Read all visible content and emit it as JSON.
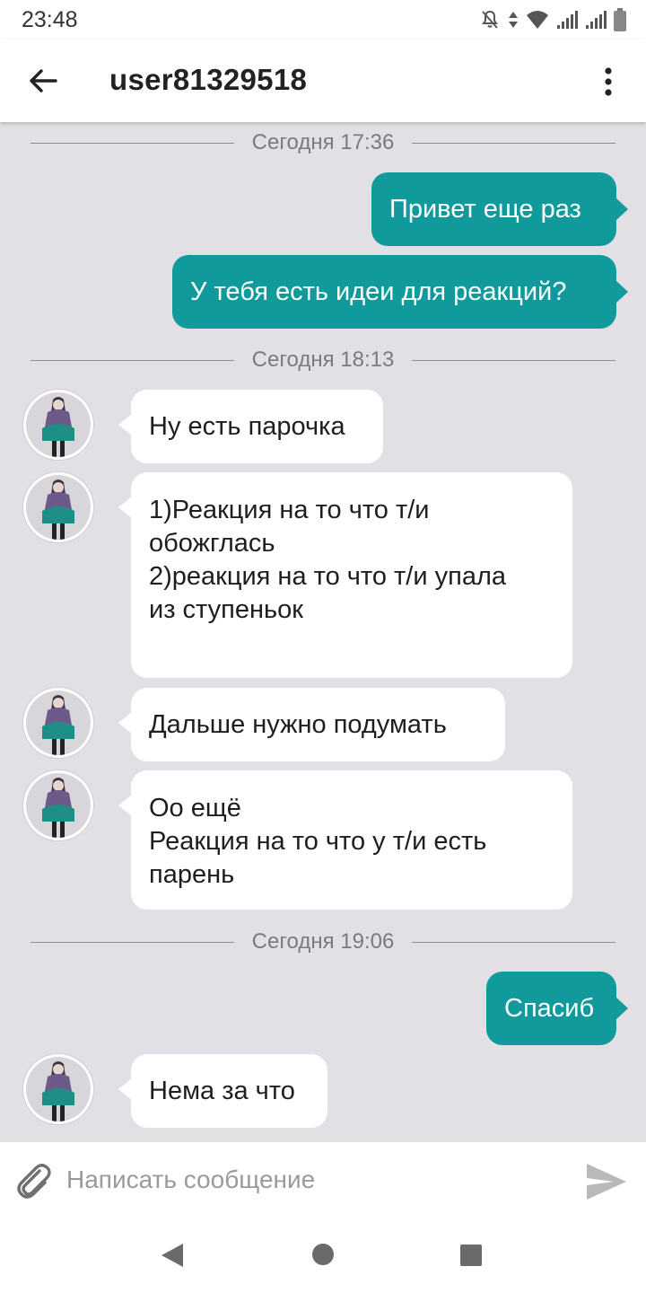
{
  "status_bar": {
    "time": "23:48",
    "icons": [
      "notifications-off-icon",
      "data-arrows-icon",
      "wifi-icon",
      "signal-icon",
      "signal-icon",
      "battery-icon"
    ]
  },
  "header": {
    "title": "user81329518",
    "back_icon": "arrow-left-icon",
    "menu_icon": "more-vertical-icon"
  },
  "messages": {
    "date_1": "Сегодня 17:36",
    "date_2": "Сегодня 18:13",
    "date_3": "Сегодня 19:06",
    "out_1": "Привет еще раз",
    "out_2": "У тебя есть идеи для реакций?",
    "in_1": "Ну есть парочка",
    "in_2": [
      "1)Реакция на то что т/и",
      "обожглась",
      "2)реакция на то что т/и упала",
      "из ступеньок"
    ],
    "in_3": "Дальше нужно подумать",
    "in_4": [
      "Оо ещё",
      "Реакция на то что у т/и есть",
      "парень"
    ],
    "out_3": "Спасиб",
    "in_5": "Нема за что"
  },
  "input": {
    "placeholder": "Написать сообщение",
    "value": ""
  },
  "colors": {
    "outgoing_bubble": "#119a9c",
    "incoming_bubble": "#ffffff",
    "chat_background": "#e2e0e4"
  },
  "nav": {
    "icons": [
      "nav-back-icon",
      "nav-home-icon",
      "nav-recent-icon"
    ]
  }
}
